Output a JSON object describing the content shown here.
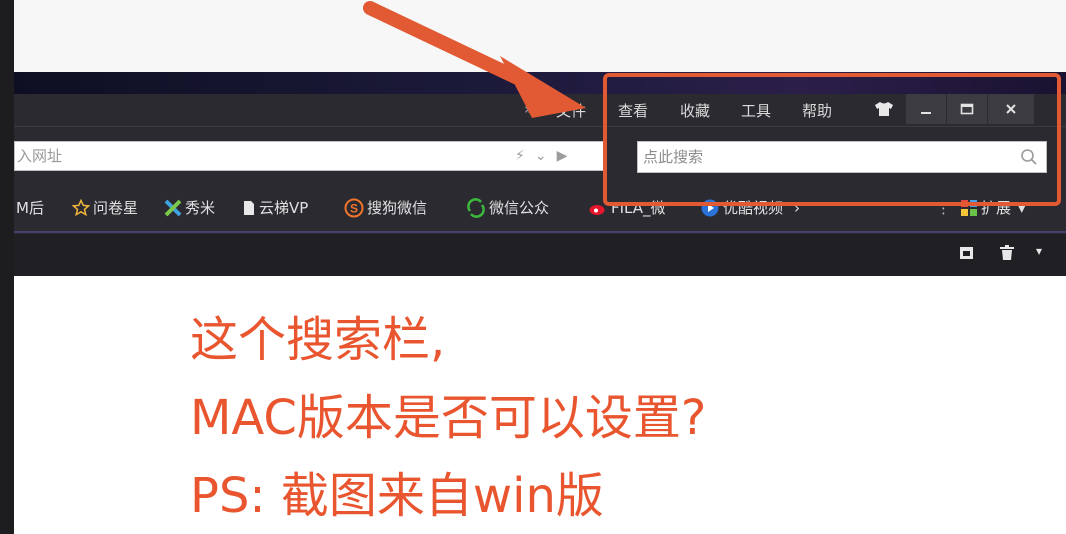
{
  "menu": {
    "overflow": "»",
    "items": [
      "文件",
      "查看",
      "收藏",
      "工具",
      "帮助"
    ]
  },
  "address": {
    "placeholder": "入网址"
  },
  "search": {
    "placeholder": "点此搜索"
  },
  "bookmarks": {
    "items": [
      "M后",
      "问卷星",
      "秀米",
      "云梯VP",
      "搜狗微信",
      "微信公众",
      "FILA_微",
      "优酷视频"
    ],
    "more": "›",
    "ext_label": "扩展"
  },
  "annotation": {
    "lines": [
      "这个搜索栏,",
      "MAC版本是否可以设置?",
      "PS: 截图来自win版"
    ]
  },
  "colors": {
    "accent": "#e25a33",
    "note_text": "#e8552f",
    "toolbar_bg": "#2a2a30"
  }
}
